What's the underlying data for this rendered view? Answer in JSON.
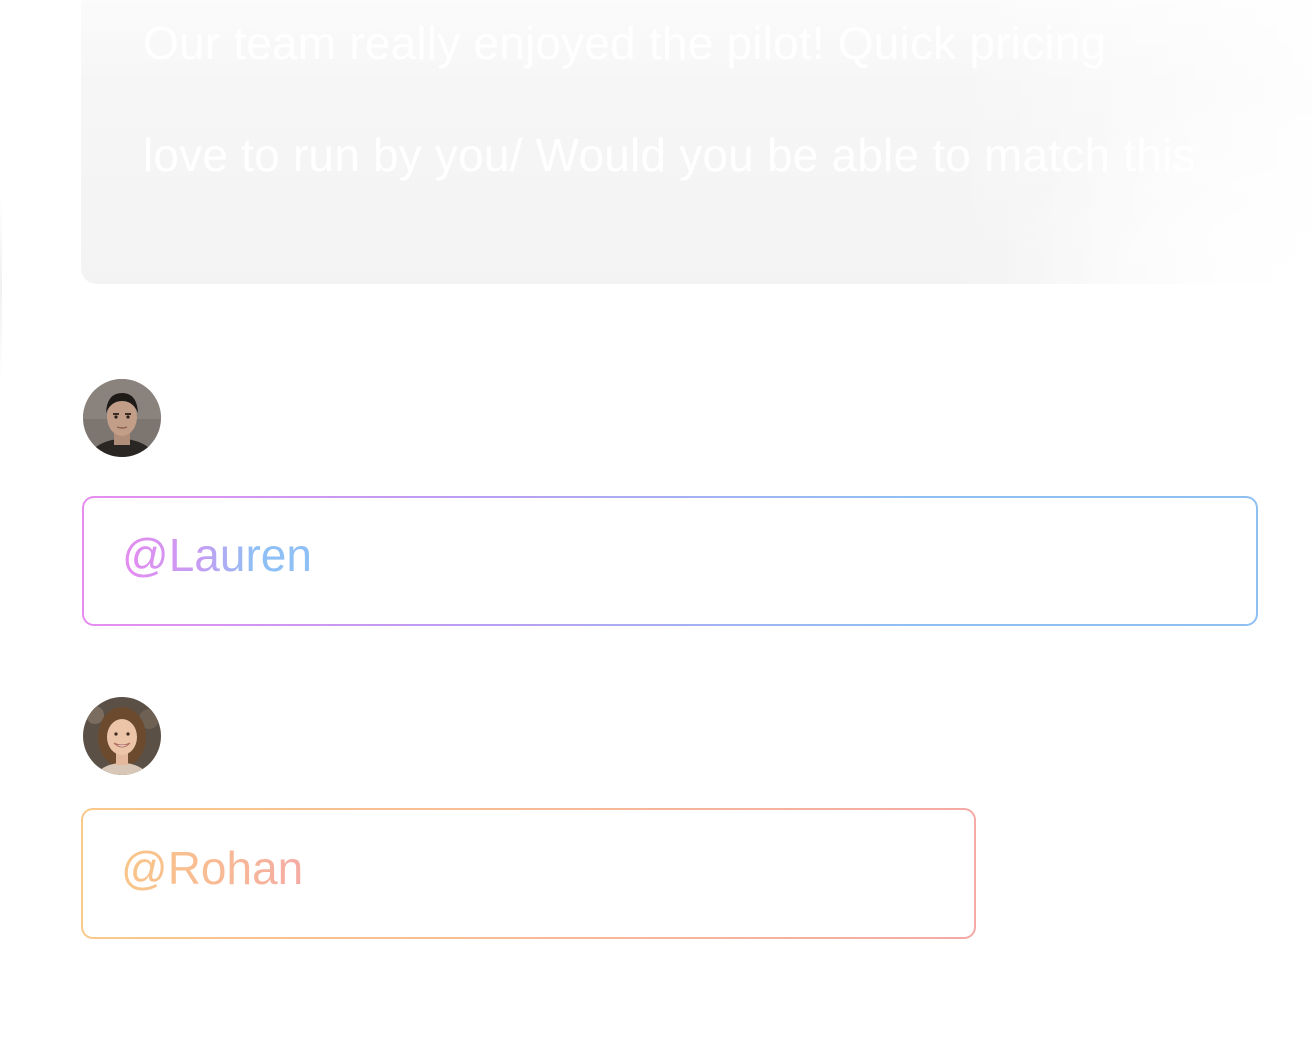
{
  "email": {
    "line1": "Our team really enjoyed the pilot! Quick pricing",
    "line2": "love to run by you/ Would you be able to match this"
  },
  "thread": [
    {
      "avatar": "avatar-man-dark-hair",
      "mention": "@Lauren",
      "accent_colors": [
        "#e78cf0",
        "#b9a0f2",
        "#8fc0f5"
      ]
    },
    {
      "avatar": "avatar-woman-smiling",
      "mention": "@Rohan",
      "accent_colors": [
        "#f9c98a",
        "#f8bb95",
        "#f4aaa5"
      ]
    }
  ]
}
